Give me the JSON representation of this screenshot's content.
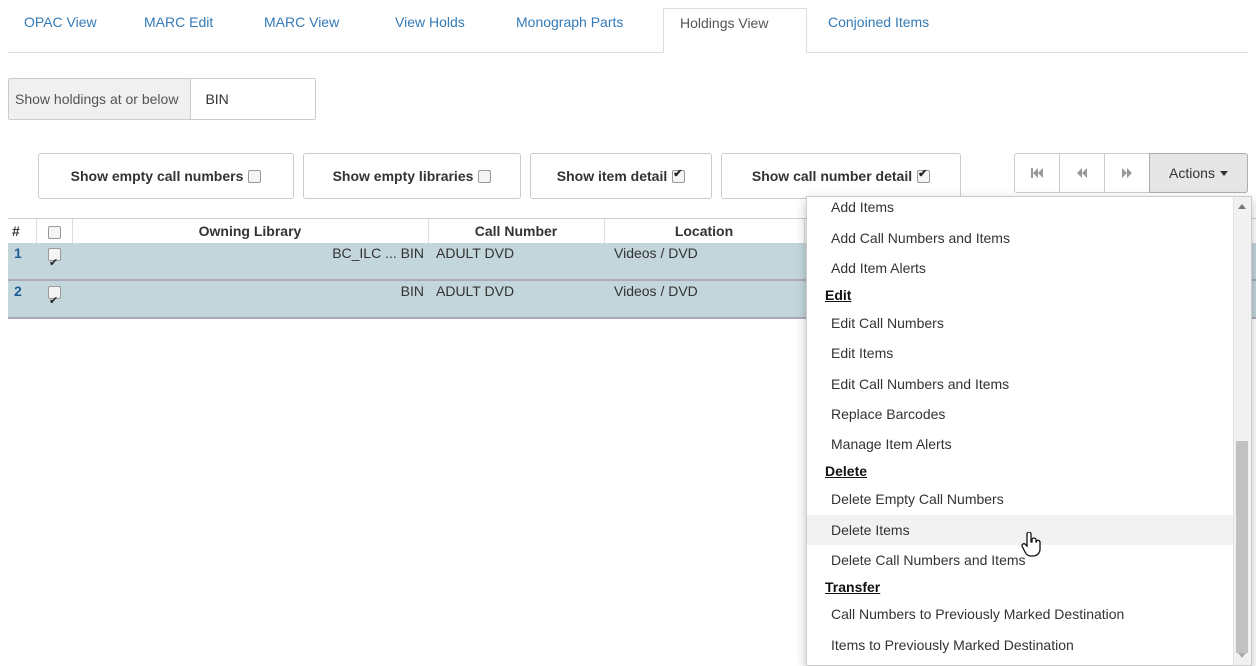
{
  "tabs": [
    "OPAC View",
    "MARC Edit",
    "MARC View",
    "View Holds",
    "Monograph Parts",
    "Holdings View",
    "Conjoined Items"
  ],
  "active_tab": "Holdings View",
  "holdings_filter": {
    "label": "Show holdings at or below",
    "value": "BIN"
  },
  "toggles": {
    "empty_call_numbers": {
      "label": "Show empty call numbers",
      "checked": false
    },
    "empty_libraries": {
      "label": "Show empty libraries",
      "checked": false
    },
    "item_detail": {
      "label": "Show item detail",
      "checked": true
    },
    "call_number_detail": {
      "label": "Show call number detail",
      "checked": true
    }
  },
  "pager": {
    "first_icon": "first-page-icon",
    "prev_icon": "previous-page-icon",
    "next_icon": "next-page-icon",
    "actions_label": "Actions"
  },
  "grid": {
    "headers": {
      "num": "#",
      "owning_library": "Owning Library",
      "call_number": "Call Number",
      "location": "Location"
    },
    "rows": [
      {
        "num": "1",
        "owning_library": "BC_ILC ... BIN",
        "call_number": "ADULT DVD",
        "location": "Videos / DVD",
        "checked": true
      },
      {
        "num": "2",
        "owning_library": "BIN",
        "call_number": "ADULT DVD",
        "location": "Videos / DVD",
        "checked": true
      }
    ]
  },
  "menu": {
    "items_add": [
      "Add Items",
      "Add Call Numbers and Items",
      "Add Item Alerts"
    ],
    "edit_header": "Edit",
    "items_edit": [
      "Edit Call Numbers",
      "Edit Items",
      "Edit Call Numbers and Items",
      "Replace Barcodes",
      "Manage Item Alerts"
    ],
    "delete_header": "Delete",
    "items_delete": [
      "Delete Empty Call Numbers",
      "Delete Items",
      "Delete Call Numbers and Items"
    ],
    "transfer_header": "Transfer",
    "items_transfer": [
      "Call Numbers to Previously Marked Destination",
      "Items to Previously Marked Destination"
    ],
    "hovered": "Delete Items"
  },
  "colors": {
    "link": "#337ab7",
    "row_bg": "#c2d6dc",
    "actions_bg": "#e6e6e6"
  }
}
